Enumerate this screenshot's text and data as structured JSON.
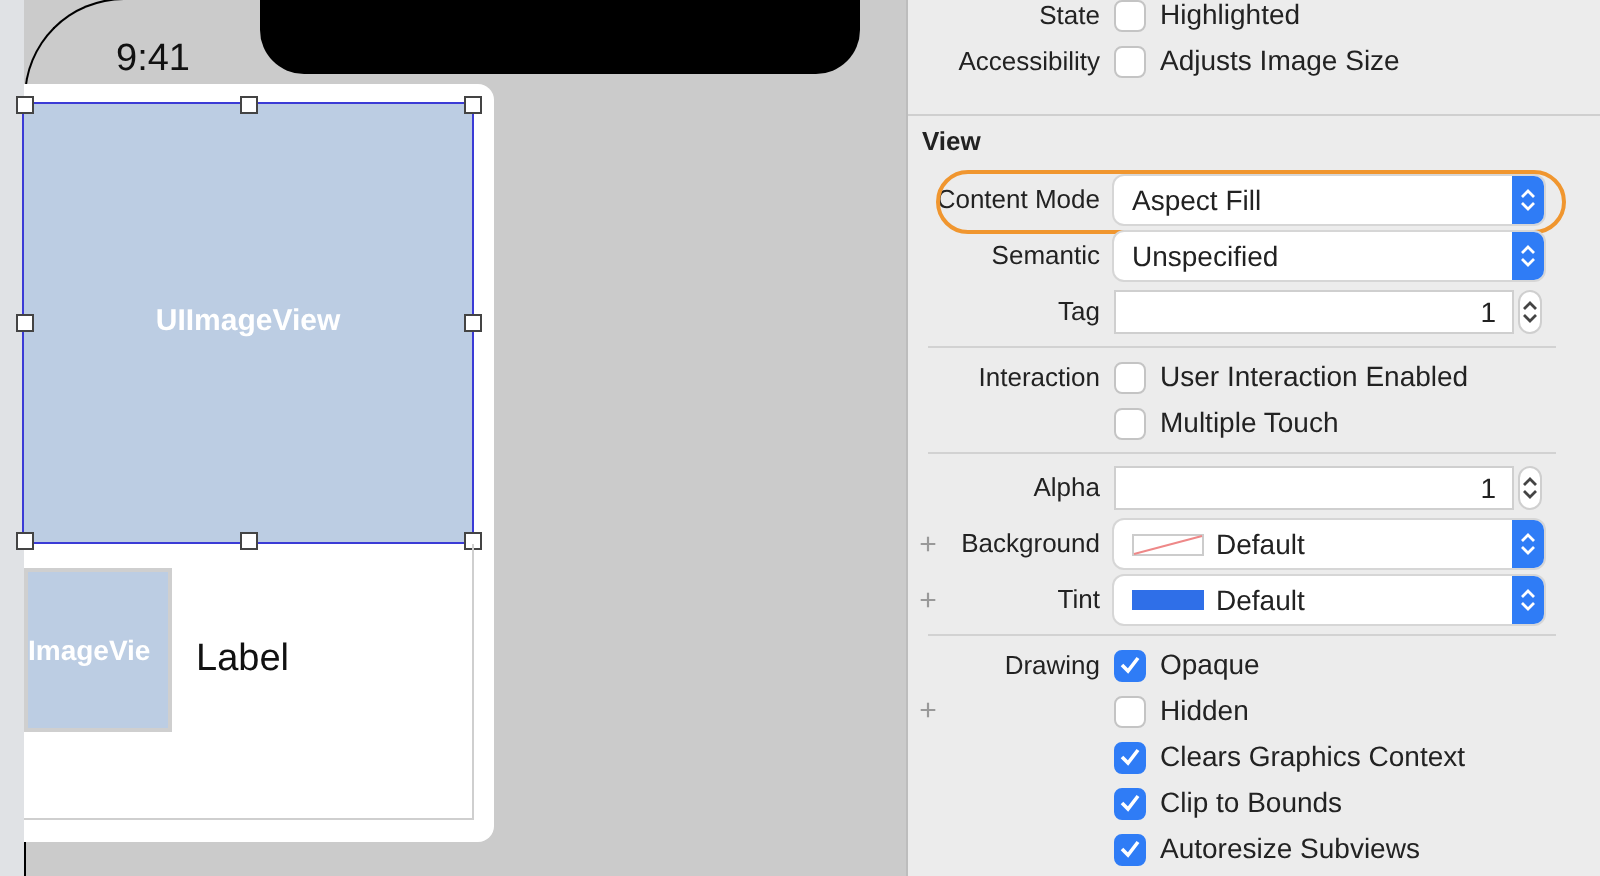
{
  "status_bar": {
    "time": "9:41"
  },
  "canvas": {
    "image_view": {
      "label": "UIImageView",
      "selected": true
    },
    "cell": {
      "image_label": "ImageVie",
      "label": "Label"
    }
  },
  "inspector": {
    "rows": [
      {
        "kind": "checkbox",
        "label": "State",
        "text": "Highlighted",
        "checked": false
      },
      {
        "kind": "checkbox",
        "label": "Accessibility",
        "text": "Adjusts Image Size",
        "checked": false
      },
      {
        "kind": "section",
        "title": "View"
      },
      {
        "kind": "select",
        "label": "Content Mode",
        "value": "Aspect Fill",
        "highlighted": true
      },
      {
        "kind": "select",
        "label": "Semantic",
        "value": "Unspecified"
      },
      {
        "kind": "stepper",
        "label": "Tag",
        "value": "1"
      },
      {
        "kind": "divider"
      },
      {
        "kind": "checkbox",
        "label": "Interaction",
        "text": "User Interaction Enabled",
        "checked": false
      },
      {
        "kind": "checkbox",
        "text": "Multiple Touch",
        "checked": false
      },
      {
        "kind": "divider"
      },
      {
        "kind": "stepper",
        "label": "Alpha",
        "value": "1"
      },
      {
        "kind": "color",
        "plus": "+",
        "label": "Background",
        "value": "Default"
      },
      {
        "kind": "color",
        "plus": "+",
        "label": "Tint",
        "value": "Default",
        "color": "#2f6fe8"
      },
      {
        "kind": "divider"
      },
      {
        "kind": "checkbox",
        "label": "Drawing",
        "text": "Opaque",
        "checked": true
      },
      {
        "kind": "checkbox",
        "plus": "+",
        "text": "Hidden",
        "checked": false
      },
      {
        "kind": "checkbox",
        "text": "Clears Graphics Context",
        "checked": true
      },
      {
        "kind": "checkbox",
        "text": "Clip to Bounds",
        "checked": true
      },
      {
        "kind": "checkbox",
        "text": "Autoresize Subviews",
        "checked": true
      }
    ]
  }
}
